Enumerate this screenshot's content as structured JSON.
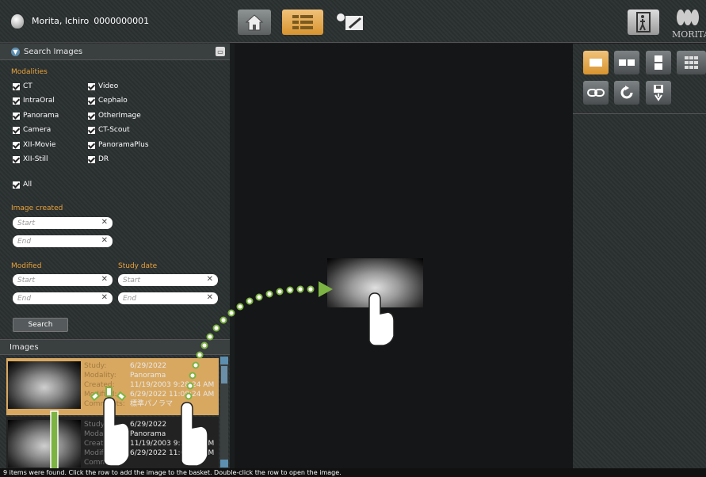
{
  "patient": {
    "name": "Morita, Ichiro",
    "id": "0000000001"
  },
  "search": {
    "title": "Search Images",
    "modalities_label": "Modalities",
    "modalities": [
      "CT",
      "Video",
      "IntraOral",
      "Cephalo",
      "Panorama",
      "OtherImage",
      "Camera",
      "CT-Scout",
      "XII-Movie",
      "PanoramaPlus",
      "XII-Still",
      "DR"
    ],
    "all_label": "All",
    "image_created_label": "Image created",
    "modified_label": "Modified",
    "study_date_label": "Study date",
    "start_placeholder": "Start",
    "end_placeholder": "End",
    "search_button": "Search"
  },
  "images": {
    "title": "Images",
    "rows": [
      {
        "study": "6/29/2022",
        "modality": "Panorama",
        "created": "11/19/2003 9:28:24 AM",
        "modified": "6/29/2022 11:08:24 AM",
        "comments": "標準パノラマ"
      },
      {
        "study": "6/29/2022",
        "modality": "Panorama",
        "created": "11/19/2003 9:28:24 AM",
        "modified": "6/29/2022 11:08:24 AM",
        "comments": ""
      }
    ],
    "labels": {
      "study": "Study:",
      "modality": "Modality:",
      "created": "Created:",
      "modified": "Modified:",
      "comments": "Comments:"
    }
  },
  "status": "9 items were found. Click the row to add the image to the basket. Double-click the row to open the image.",
  "logo_text": "MORITA",
  "colors": {
    "accent": "#d8942f",
    "green": "#7cb342"
  }
}
